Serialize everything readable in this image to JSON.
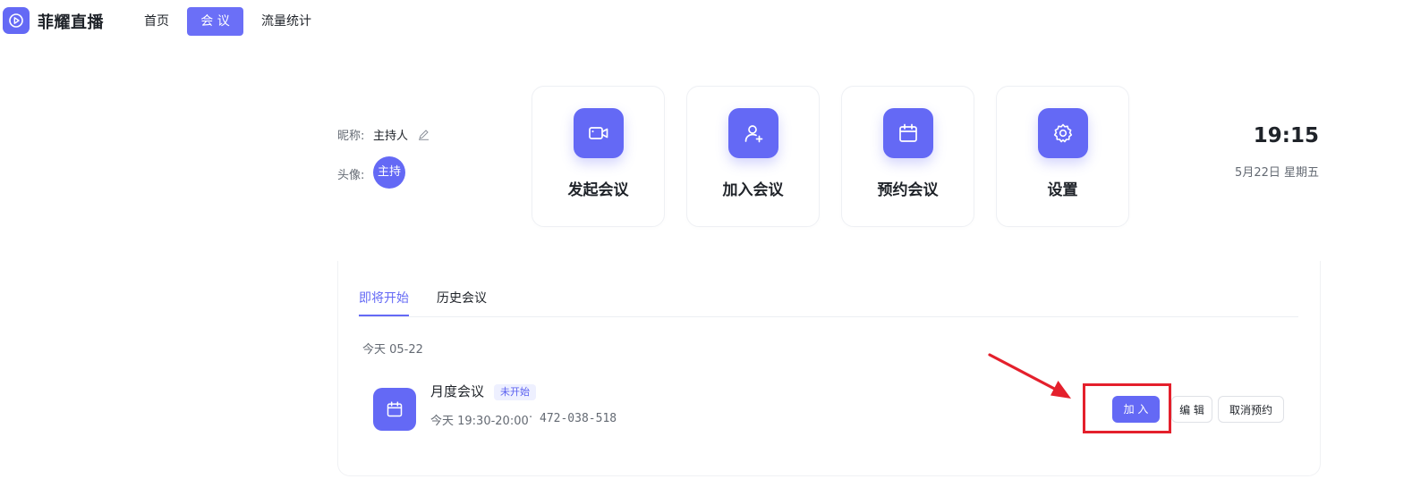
{
  "brand": {
    "name": "菲耀直播",
    "logo_icon": "play-circle-icon",
    "accent": "#6469f5"
  },
  "nav": {
    "home": "首页",
    "meeting": "会 议",
    "stats": "流量统计",
    "active": "会 议"
  },
  "profile": {
    "nickname_label": "昵称:",
    "nickname": "主持人",
    "avatar_label": "头像:",
    "avatar_text": "主持"
  },
  "actions": [
    {
      "label": "发起会议",
      "icon": "video-icon"
    },
    {
      "label": "加入会议",
      "icon": "user-plus-icon"
    },
    {
      "label": "预约会议",
      "icon": "calendar-icon"
    },
    {
      "label": "设置",
      "icon": "gear-icon"
    }
  ],
  "clock": {
    "time": "19:15",
    "date": "5月22日 星期五"
  },
  "tabs": {
    "upcoming": "即将开始",
    "history": "历史会议",
    "active": "即将开始"
  },
  "day_label": "今天 05-22",
  "meeting": {
    "title": "月度会议",
    "status": "未开始",
    "time": "今天 19:30-20:00",
    "separator": "·",
    "id": "472-038-518",
    "join_label": "加 入",
    "edit_label": "编 辑",
    "cancel_label": "取消预约"
  },
  "annotation": {
    "color": "#e4202c"
  }
}
